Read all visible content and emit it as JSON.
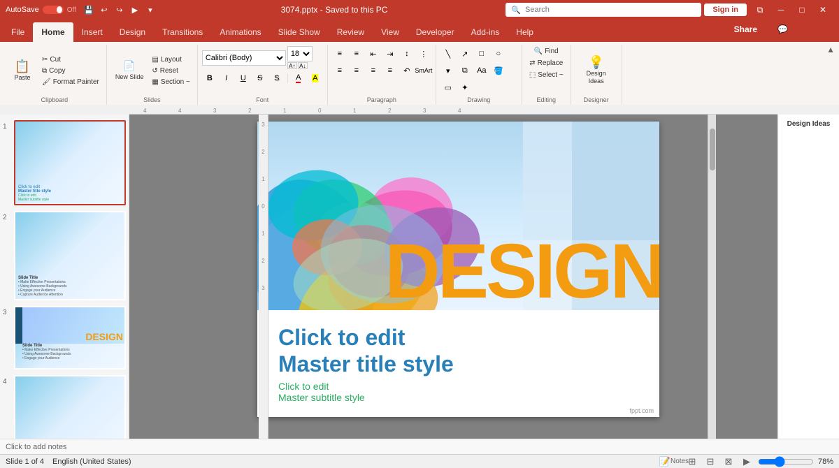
{
  "titleBar": {
    "appName": "AutoSave",
    "autoSaveOff": "Off",
    "fileName": "3074.pptx - Saved to this PC",
    "searchPlaceholder": "Search",
    "signInLabel": "Sign in"
  },
  "ribbonTabs": {
    "tabs": [
      "File",
      "Home",
      "Insert",
      "Design",
      "Transitions",
      "Animations",
      "Slide Show",
      "Review",
      "View",
      "Developer",
      "Add-ins",
      "Help"
    ],
    "activeTab": "Home"
  },
  "ribbonGroups": {
    "clipboard": {
      "label": "Clipboard",
      "paste": "Paste",
      "cut": "Cut",
      "copy": "Copy",
      "formatPainter": "Format Painter"
    },
    "slides": {
      "label": "Slides",
      "newSlide": "New Slide",
      "layout": "Layout",
      "reset": "Reset",
      "section": "Section ~"
    },
    "font": {
      "label": "Font",
      "fontFamily": "Calibri (Body)",
      "fontSize": "18",
      "bold": "B",
      "italic": "I",
      "underline": "U",
      "strikethrough": "S",
      "shadow": "S",
      "fontColor": "A",
      "highlightColor": "A"
    },
    "paragraph": {
      "label": "Paragraph"
    },
    "drawing": {
      "label": "Drawing"
    },
    "editing": {
      "label": "Editing",
      "find": "Find",
      "replace": "Replace",
      "select": "Select ~"
    },
    "designer": {
      "label": "Designer",
      "designIdeas": "Design Ideas"
    }
  },
  "shareBtn": "Share",
  "commentsBtn": "Comments",
  "slidePanel": {
    "slides": [
      {
        "num": "1",
        "active": true
      },
      {
        "num": "2",
        "active": false
      },
      {
        "num": "3",
        "active": false
      },
      {
        "num": "4",
        "active": false
      }
    ]
  },
  "canvas": {
    "designTitle": "DESIGN",
    "clickToEdit": "Click to edit",
    "masterTitleStyle": "Master title style",
    "clickToEdit2": "Click to edit",
    "masterSubtitleStyle": "Master subtitle style",
    "watermark": "fppt.com",
    "addNotes": "Click to add notes"
  },
  "statusBar": {
    "slideInfo": "Slide 1 of 4",
    "language": "English (United States)",
    "notes": "Notes",
    "zoom": "78%"
  }
}
